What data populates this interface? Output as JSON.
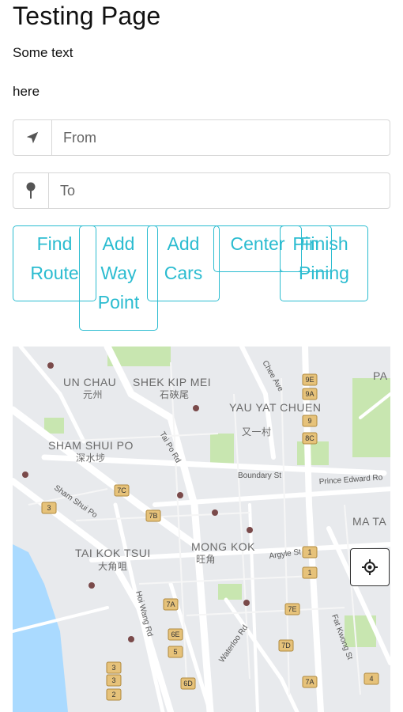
{
  "page": {
    "title": "Testing Page",
    "text_line1": "Some text",
    "text_line2": "here"
  },
  "from": {
    "placeholder": "From",
    "icon": "location-arrow-icon"
  },
  "to": {
    "placeholder": "To",
    "icon": "map-pin-icon"
  },
  "buttons": {
    "find_route": "Find Route",
    "add_way_point": "Add Way Point",
    "add_cars": "Add Cars",
    "center": "Center",
    "pin": "Pin",
    "finish_pining": "Finish Pining"
  },
  "colors": {
    "accent": "#2bbcd0",
    "map_water": "#aadaff",
    "map_park": "#c8e6b0"
  },
  "map": {
    "labels": {
      "un_chau": "UN CHAU",
      "un_chau_cn": "元州",
      "shek_kip_mei": "SHEK KIP MEI",
      "shek_kip_mei_cn": "石硤尾",
      "yau_yat_chuen": "YAU YAT CHUEN",
      "yau_yat_chuen_cn": "又一村",
      "sham_shui_po": "SHAM SHUI PO",
      "sham_shui_po_cn": "深水埗",
      "tai_kok_tsui": "TAI KOK TSUI",
      "tai_kok_tsui_cn": "大角咀",
      "mong_kok": "MONG KOK",
      "mong_kok_cn": "旺角",
      "ma_ta": "MA TA",
      "pa": "PA",
      "boundary_st": "Boundary St",
      "prince_edward_rd": "Prince Edward Ro",
      "argyle_st": "Argyle St",
      "tai_po_rd": "Tai Po Rd",
      "sham_shui_po_rd": "Sham Shui Po",
      "hoi_wang_rd": "Hoi Wang Rd",
      "waterloo_rd": "Waterloo Rd",
      "fat_kwong_st": "Fat Kwong St",
      "chee_ave": "Chee Ave"
    },
    "route_shields": [
      "7C",
      "7B",
      "7A",
      "6E",
      "5",
      "6D",
      "3",
      "3",
      "3",
      "2",
      "1",
      "1",
      "7E",
      "7D",
      "7A",
      "4",
      "9E",
      "9A",
      "8C",
      "9"
    ],
    "locate_icon": "crosshair-icon"
  }
}
